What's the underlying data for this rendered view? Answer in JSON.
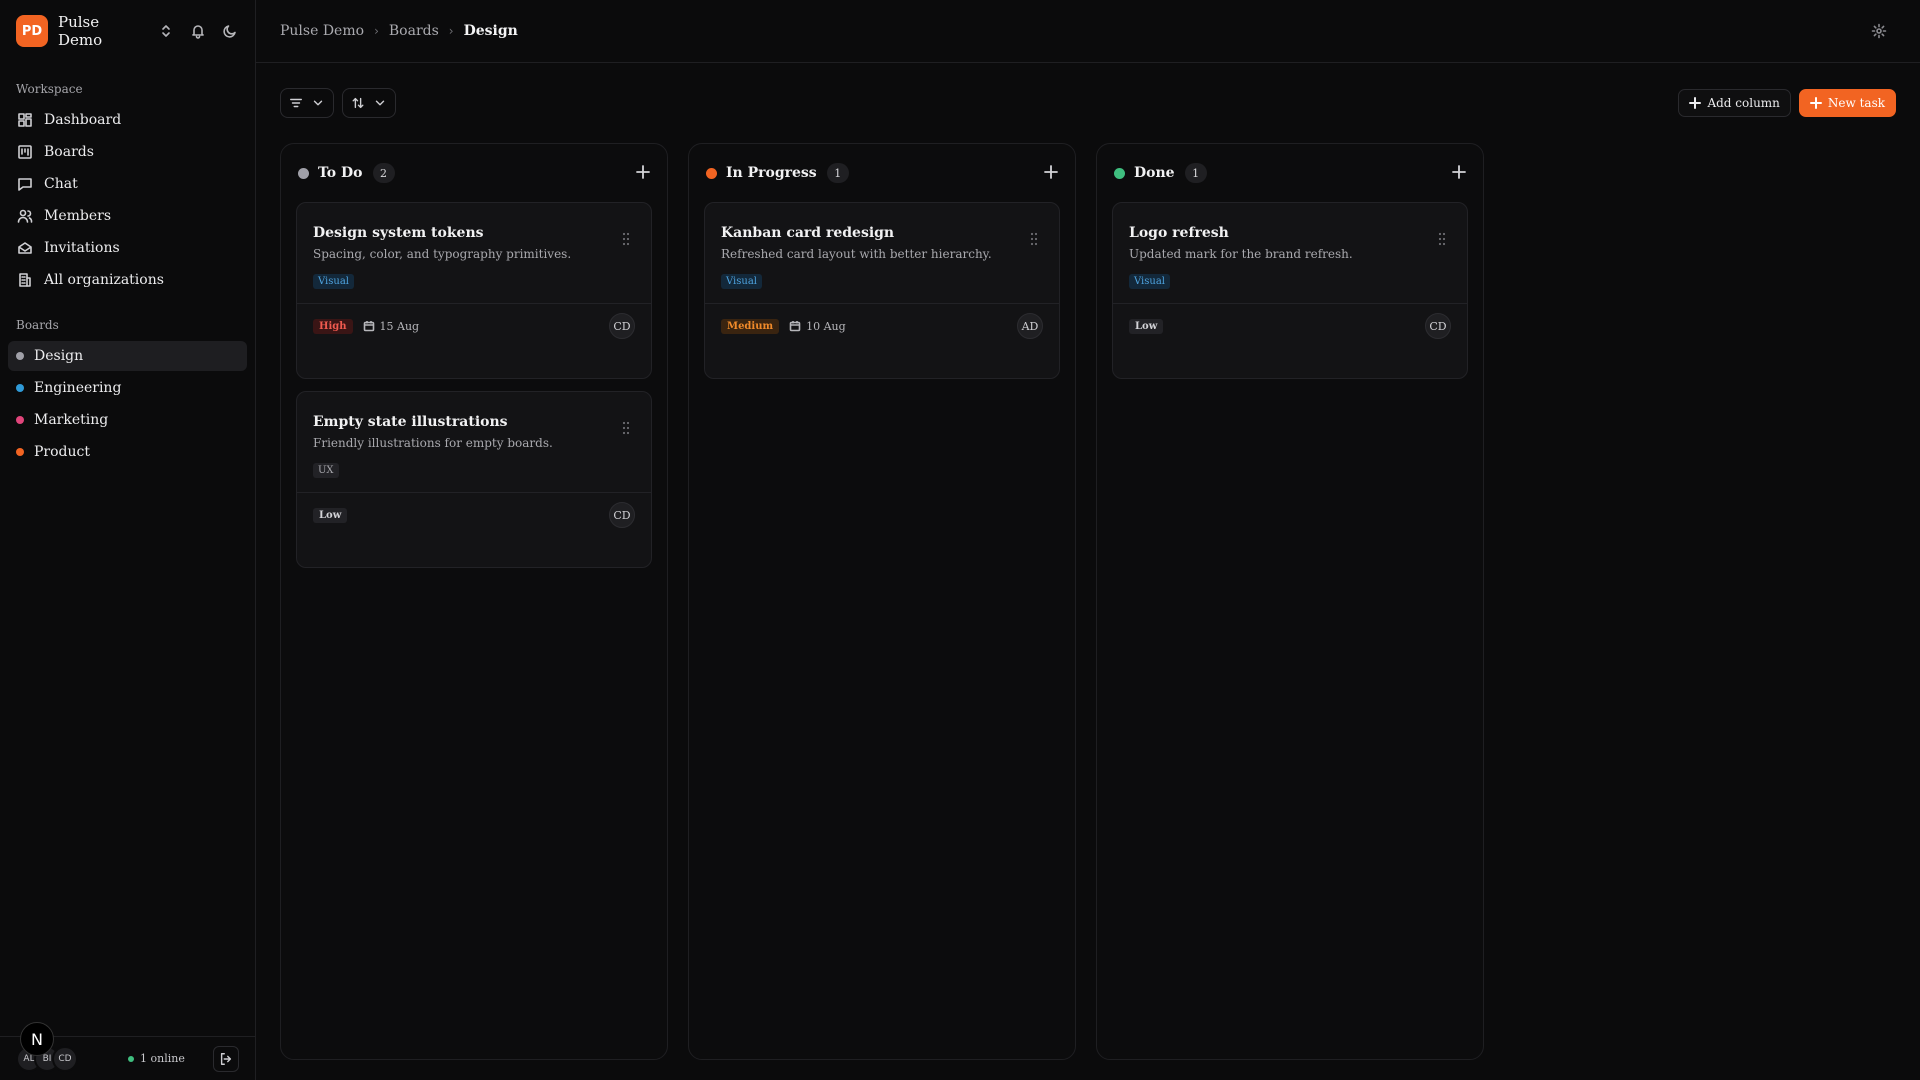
{
  "org": {
    "initials": "PD",
    "name": "Pulse Demo",
    "accent": "#f26422"
  },
  "sidebar": {
    "workspace_label": "Workspace",
    "nav": [
      {
        "label": "Dashboard",
        "icon": "dashboard-icon"
      },
      {
        "label": "Boards",
        "icon": "boards-icon"
      },
      {
        "label": "Chat",
        "icon": "chat-icon"
      },
      {
        "label": "Members",
        "icon": "members-icon"
      },
      {
        "label": "Invitations",
        "icon": "invitations-icon"
      },
      {
        "label": "All organizations",
        "icon": "organizations-icon"
      }
    ],
    "boards_label": "Boards",
    "boards": [
      {
        "label": "Design",
        "color": "#a0a0a8",
        "active": true
      },
      {
        "label": "Engineering",
        "color": "#2f9ad8",
        "active": false
      },
      {
        "label": "Marketing",
        "color": "#e0457b",
        "active": false
      },
      {
        "label": "Product",
        "color": "#f26422",
        "active": false
      }
    ],
    "footer": {
      "avatars": [
        "AL",
        "BI",
        "CD"
      ],
      "online": "1 online",
      "online_color": "#3fbf7f",
      "badge": "N"
    }
  },
  "breadcrumb": {
    "root": "Pulse Demo",
    "section": "Boards",
    "current": "Design"
  },
  "toolbar": {
    "add_column": "Add column",
    "new_task": "New task"
  },
  "columns": [
    {
      "title": "To Do",
      "count": "2",
      "color": "#a0a0a8",
      "cards": [
        {
          "title": "Design system tokens",
          "desc": "Spacing, color, and typography primitives.",
          "tag": "Visual",
          "priority": "High",
          "date": "15 Aug",
          "assignee": "CD"
        },
        {
          "title": "Empty state illustrations",
          "desc": "Friendly illustrations for empty boards.",
          "tag": "UX",
          "priority": "Low",
          "date": "",
          "assignee": "CD"
        }
      ]
    },
    {
      "title": "In Progress",
      "count": "1",
      "color": "#f26422",
      "cards": [
        {
          "title": "Kanban card redesign",
          "desc": "Refreshed card layout with better hierarchy.",
          "tag": "Visual",
          "priority": "Medium",
          "date": "10 Aug",
          "assignee": "AD"
        }
      ]
    },
    {
      "title": "Done",
      "count": "1",
      "color": "#3fbf7f",
      "cards": [
        {
          "title": "Logo refresh",
          "desc": "Updated mark for the brand refresh.",
          "tag": "Visual",
          "priority": "Low",
          "date": "",
          "assignee": "CD"
        }
      ]
    }
  ]
}
